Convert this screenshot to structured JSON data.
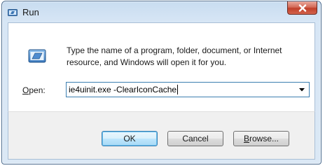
{
  "window": {
    "title": "Run",
    "close_label": "x"
  },
  "dialog": {
    "description": "Type the name of a program, folder, document, or Internet resource, and Windows will open it for you.",
    "open_label_mnemonic": "O",
    "open_label_rest": "pen:",
    "input_value": "ie4uinit.exe -ClearIconCache"
  },
  "buttons": {
    "ok_label": "OK",
    "cancel_label": "Cancel",
    "browse_mnemonic": "B",
    "browse_rest": "rowse..."
  },
  "icons": {
    "title_icon": "run-icon",
    "dialog_icon": "run-icon",
    "close_icon": "close-icon",
    "dropdown_icon": "chevron-down-icon"
  },
  "colors": {
    "close_button": "#c0402a",
    "default_button_border": "#3c7fb1",
    "window_frame": "#d7e6f5"
  }
}
